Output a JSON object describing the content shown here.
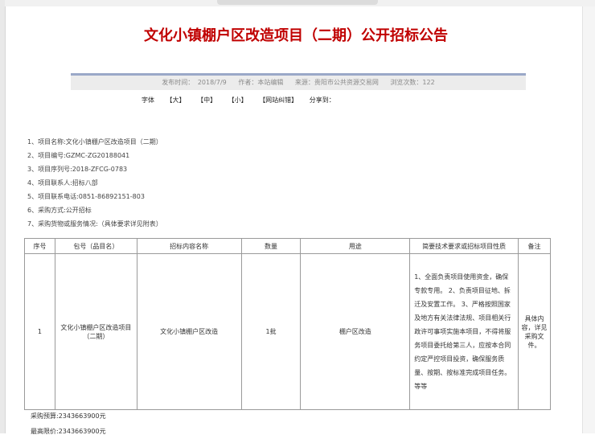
{
  "title": "文化小镇棚户区改造项目（二期）公开招标公告",
  "meta": {
    "publish_time": "发布时间： 2018/7/9",
    "author": "作者：本站编辑",
    "source": "来源：贵阳市公共资源交易网",
    "views": "浏览次数：122"
  },
  "fontbar": {
    "font_label": "字体",
    "large": "【大】",
    "medium": "【中】",
    "small": "【小】",
    "correction": "【网站纠错】",
    "share": "分享到："
  },
  "items": [
    "1、项目名称:文化小镇棚户区改造项目（二期）",
    "2、项目编号:GZMC-ZG20188041",
    "3、项目序列号:2018-ZFCG-0783",
    "4、项目联系人:招标八部",
    "5、项目联系电话:0851-86892151-803",
    "6、采购方式:公开招标",
    "7、采购货物或服务情况:（具体要求详见附表）"
  ],
  "table": {
    "headers": [
      "序号",
      "包号（品目名）",
      "招标内容名称",
      "数量",
      "用途",
      "简要技术要求或招标项目性质",
      "备注"
    ],
    "row": {
      "no": "1",
      "package": "文化小镇棚户区改造项目（二期）",
      "content": "文化小镇棚户区改造",
      "quantity": "1批",
      "usage": "棚户区改造",
      "requirements": "1、全面负责项目使用资金，确保专款专用。 2、负责项目征地、拆迁及安置工作。 3、严格按照国家及地方有关法律法规、项目相关行政许可事项实施本项目，不得将服务项目委托给第三人，应按本合同约定严控项目投资，确保服务质量、按期、按标准完成项目任务。等等",
      "remarks": "具体内容，详见采购文件。"
    }
  },
  "budget": "采购预算:2343663900元",
  "max_price": "最高限价:2343663900元"
}
